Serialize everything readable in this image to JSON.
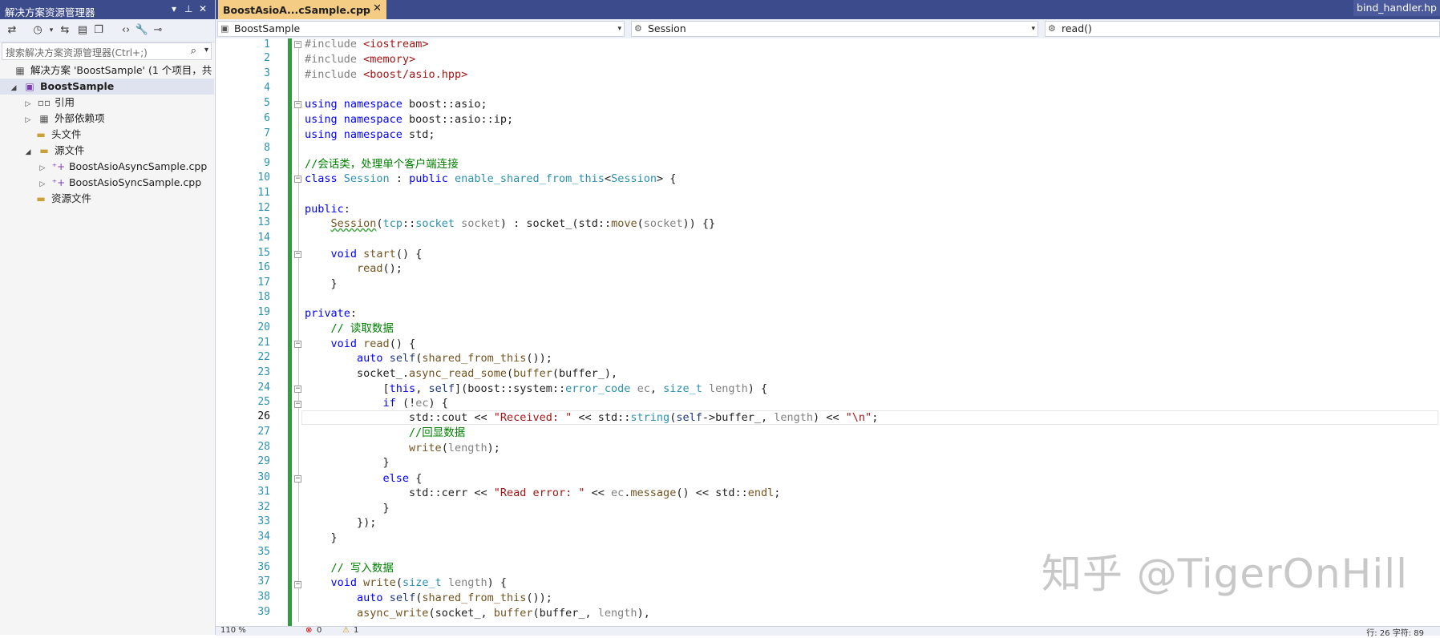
{
  "solution_explorer": {
    "title": "解决方案资源管理器",
    "search_placeholder": "搜索解决方案资源管理器(Ctrl+;)",
    "solution_label": "解决方案 'BoostSample' (1 个项目，共 1",
    "project": "BoostSample",
    "items": {
      "references": "引用",
      "external_deps": "外部依赖项",
      "headers": "头文件",
      "sources": "源文件",
      "file1": "BoostAsioAsyncSample.cpp",
      "file2": "BoostAsioSyncSample.cpp",
      "resources": "资源文件"
    }
  },
  "tabs": {
    "active": "BoostAsioA...cSample.cpp",
    "right": "bind_handler.hp"
  },
  "navbar": {
    "project": "BoostSample",
    "scope": "Session",
    "member": "read()"
  },
  "editor": {
    "line_numbers": [
      "1",
      "2",
      "3",
      "4",
      "5",
      "6",
      "7",
      "8",
      "9",
      "10",
      "11",
      "12",
      "13",
      "14",
      "15",
      "16",
      "17",
      "18",
      "19",
      "20",
      "21",
      "22",
      "23",
      "24",
      "25",
      "26",
      "27",
      "28",
      "29",
      "30",
      "31",
      "32",
      "33",
      "34",
      "35",
      "36",
      "37",
      "38",
      "39"
    ],
    "current_line": "26"
  },
  "status": {
    "zoom": "110 %",
    "errors": "0",
    "warnings": "1",
    "position": "行: 26    字符: 89"
  },
  "watermark": "知乎 @TigerOnHill"
}
